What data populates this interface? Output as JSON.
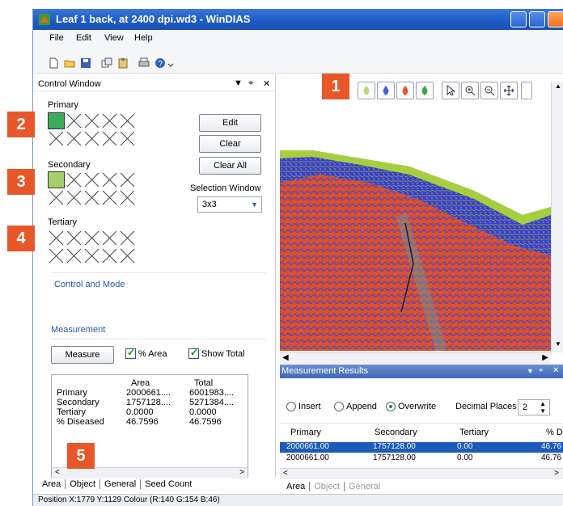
{
  "window": {
    "title": "Leaf 1 back, at 2400 dpi.wd3 - WinDIAS"
  },
  "menu": [
    "File",
    "Edit",
    "View",
    "Help"
  ],
  "control_window": {
    "title": "Control Window",
    "primary_label": "Primary",
    "secondary_label": "Secondary",
    "tertiary_label": "Tertiary",
    "edit_label": "Edit",
    "clear_label": "Clear",
    "clear_all_label": "Clear All",
    "selection_window_label": "Selection Window",
    "selection_window_value": "3x3",
    "control_mode_label": "Control and Mode",
    "measurement_label": "Measurement",
    "measure_label": "Measure",
    "pct_area_label": "% Area",
    "show_total_label": "Show Total",
    "primary_color": "#3cac5c",
    "secondary_color": "#a6cf6e"
  },
  "results": {
    "header": [
      "",
      "Area",
      "Total"
    ],
    "rows": [
      [
        "Primary",
        "2000661....",
        "6001983...."
      ],
      [
        "Secondary",
        "1757128....",
        "5271384...."
      ],
      [
        "Tertiary",
        "0.0000",
        "0.0000"
      ],
      [
        "% Diseased",
        "46.7596",
        "46.7596"
      ]
    ]
  },
  "left_tabs": [
    "Area",
    "Object",
    "General",
    "Seed Count"
  ],
  "status": "Position  X:1779 Y:1129  Colour (R:140 G:154 B:46)",
  "measurement_results": {
    "title": "Measurement Results",
    "insert_label": "Insert",
    "append_label": "Append",
    "overwrite_label": "Overwrite",
    "decimal_places_label": "Decimal Places",
    "decimal_places_value": "2",
    "columns": [
      "Primary",
      "Secondary",
      "Tertiary",
      "% D"
    ],
    "rows": [
      [
        "2000661.00",
        "1757128.00",
        "0.00",
        "46.76"
      ],
      [
        "2000661.00",
        "1757128.00",
        "0.00",
        "46.76"
      ]
    ],
    "tabs": [
      "Area",
      "Object",
      "General"
    ]
  },
  "badges": [
    "1",
    "2",
    "3",
    "4",
    "5"
  ],
  "icons": [
    "new-file-icon",
    "open-folder-icon",
    "save-icon",
    "copy-icon",
    "paste-icon",
    "print-icon",
    "help-icon",
    "pointer-icon",
    "zoom-in-icon",
    "zoom-out-icon",
    "pan-icon"
  ]
}
